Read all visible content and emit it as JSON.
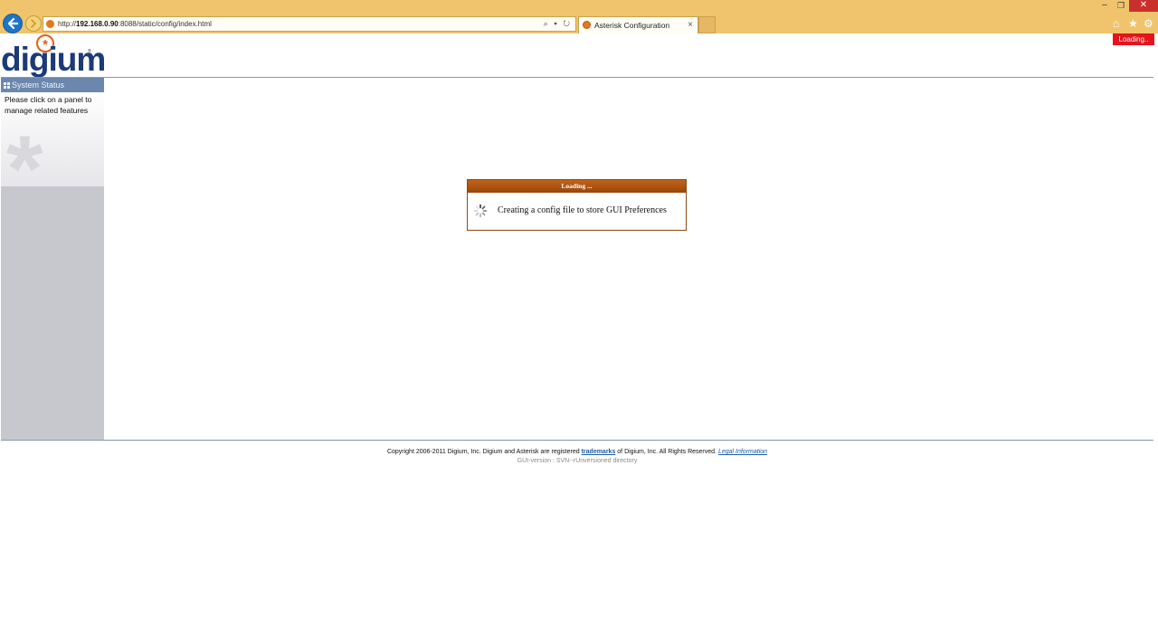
{
  "browser": {
    "address": {
      "prefix": "http://",
      "host": "192.168.0.90",
      "rest": ":8088/static/config/index.html",
      "controls": "⌕ ▾ ↻"
    },
    "tab": {
      "title": "Asterisk Configuration",
      "close": "×"
    },
    "window": {
      "minimize": "–",
      "maximize": "❐",
      "close": "✕"
    },
    "toolbar": {
      "home_icon": "⌂",
      "favorites_icon": "★",
      "tools_icon": "⚙"
    }
  },
  "page": {
    "loading_badge": "Loading..",
    "logo": {
      "text": "digium",
      "reg": "®"
    },
    "sidebar": {
      "header": "System Status",
      "message": "Please click on a panel to manage related features"
    },
    "dialog": {
      "title": "Loading ...",
      "message": "Creating a config file to store GUI Preferences"
    },
    "footer": {
      "copyright_pre": "Copyright 2006-2011 Digium, Inc. Digium and Asterisk are registered ",
      "trademarks_link": "trademarks",
      "copyright_post": " of Digium, Inc. All Rights Reserved. ",
      "legal_link": "Legal Information",
      "gui_version": "GUI-version : SVN--rUnversioned directory"
    }
  },
  "colors": {
    "chrome_bg": "#f0c46c",
    "brand_blue": "#1c3a78",
    "brand_orange": "#e05f1a",
    "sidebar_header": "#6c87ad",
    "sidebar_bg": "#c7c8ce",
    "dialog_header": "#b05a12",
    "loading_red": "#e5131b"
  }
}
